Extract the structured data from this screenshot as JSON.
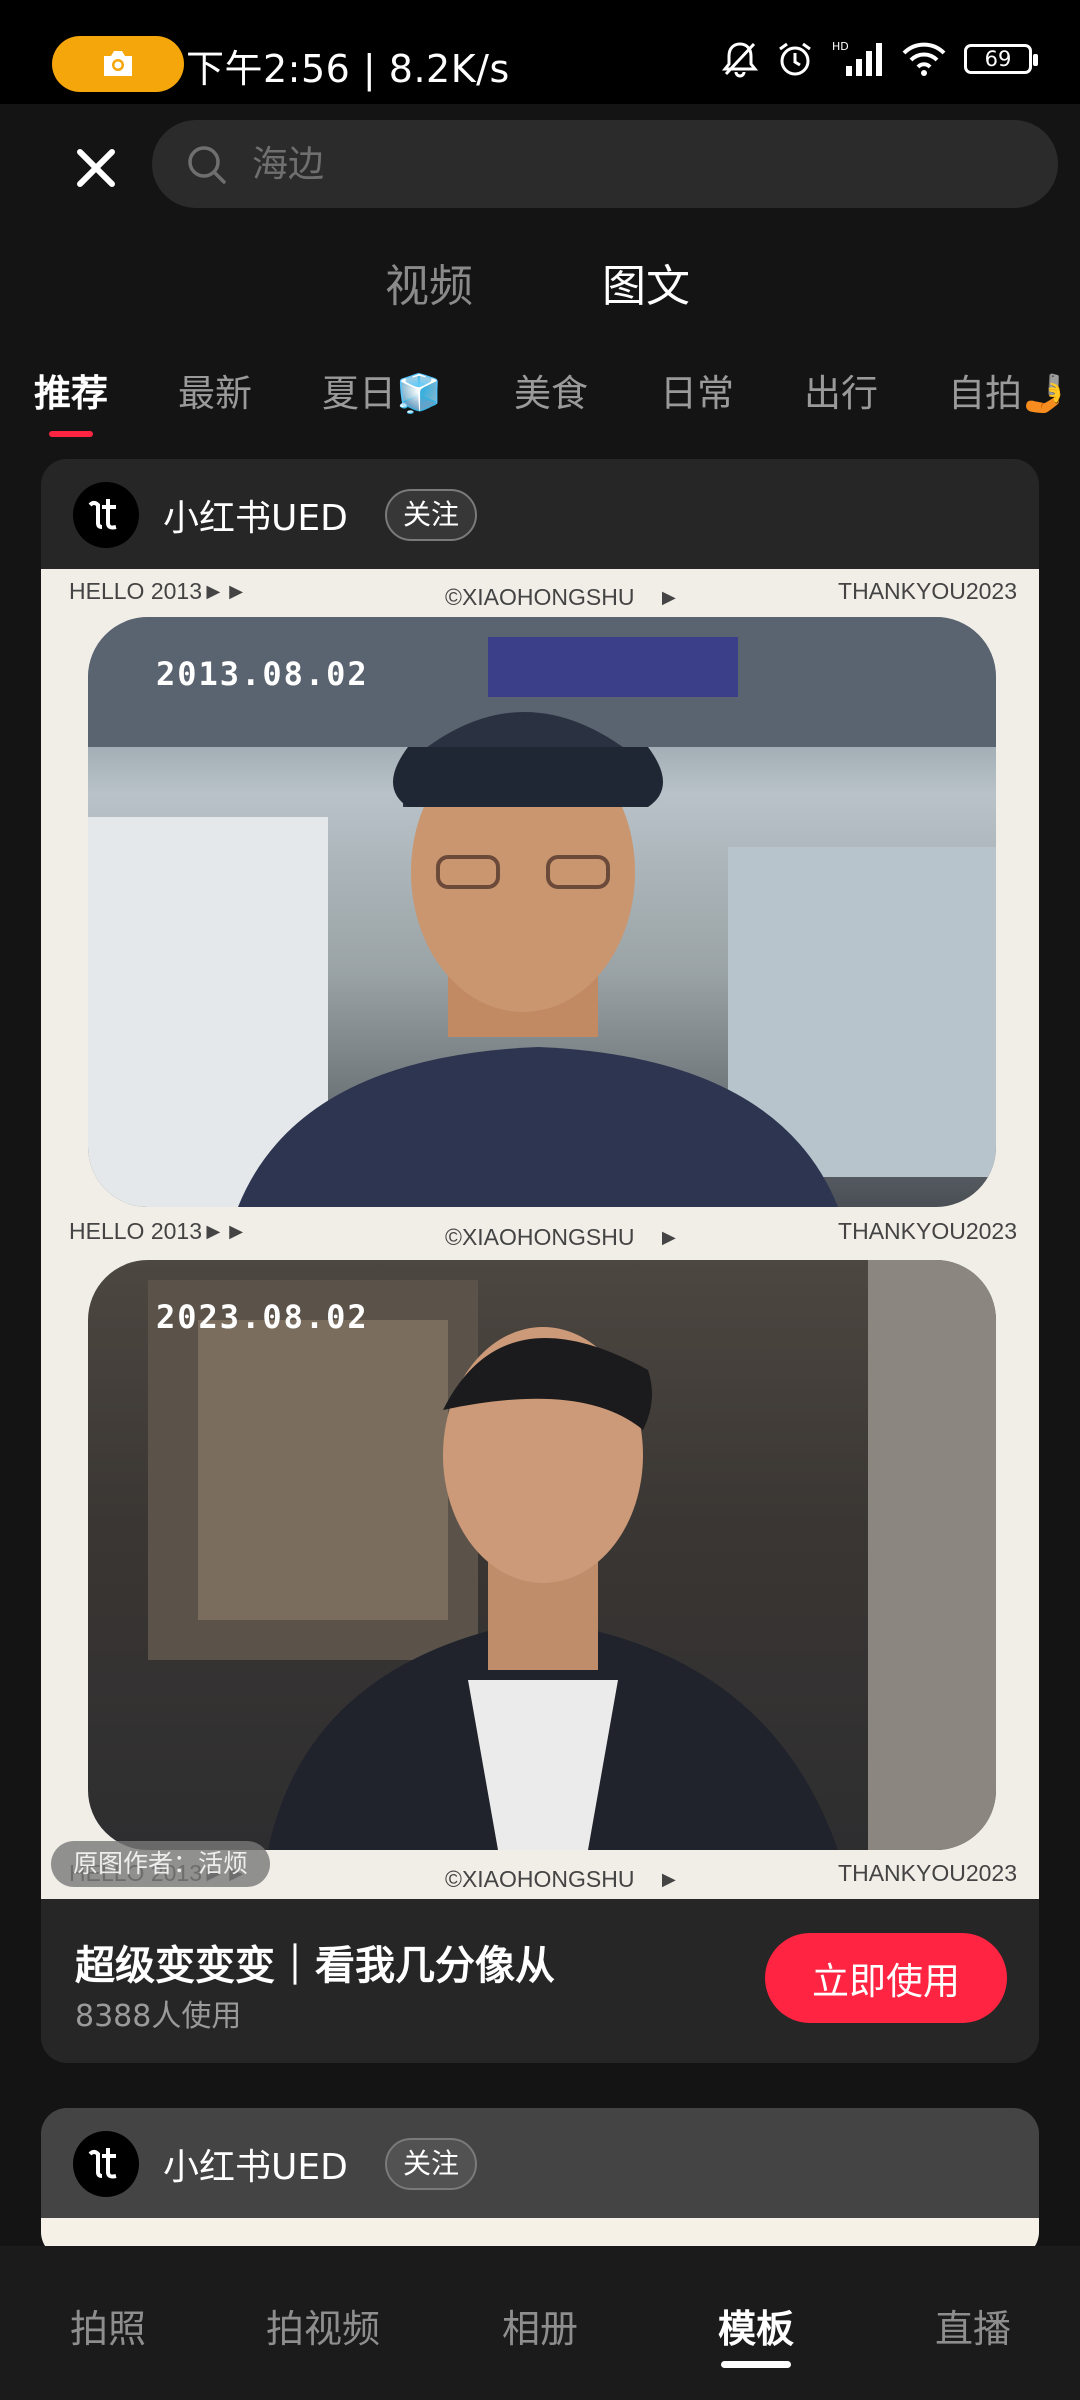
{
  "status_bar": {
    "time": "下午2:56 | 8.2K/s",
    "battery": "69"
  },
  "search": {
    "placeholder": "海边"
  },
  "mode_tabs": [
    {
      "label": "视频"
    },
    {
      "label": "图文"
    }
  ],
  "categories": [
    {
      "label": "推荐"
    },
    {
      "label": "最新"
    },
    {
      "label": "夏日🧊"
    },
    {
      "label": "美食"
    },
    {
      "label": "日常"
    },
    {
      "label": "出行"
    },
    {
      "label": "自拍🤳"
    }
  ],
  "card1": {
    "author": "小红书UED",
    "follow_label": "关注",
    "strip": {
      "left": "HELLO 2013►►",
      "center": "©XIAOHONGSHU　►",
      "right": "THANKYOU2023"
    },
    "photo1_date": "2013.08.02",
    "photo2_date": "2023.08.02",
    "credit": "原图作者：活烦",
    "title": "超级变变变｜看我几分像从",
    "usage": "8388人使用",
    "use_button": "立即使用"
  },
  "card2": {
    "author": "小红书UED",
    "follow_label": "关注"
  },
  "bottom_nav": [
    {
      "label": "拍照"
    },
    {
      "label": "拍视频"
    },
    {
      "label": "相册"
    },
    {
      "label": "模板"
    },
    {
      "label": "直播"
    }
  ],
  "colors": {
    "accent": "#ff2442",
    "background": "#141414",
    "card": "#262626"
  }
}
